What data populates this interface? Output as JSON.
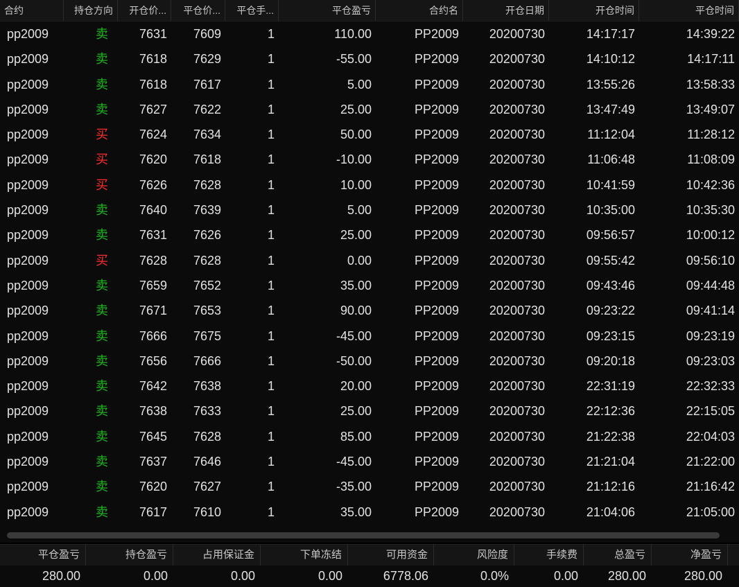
{
  "table": {
    "headers": [
      "合约",
      "持仓方向",
      "开仓价...",
      "平仓价...",
      "平仓手...",
      "平仓盈亏",
      "合约名",
      "开仓日期",
      "开仓时间",
      "平仓时间"
    ],
    "rows": [
      [
        "pp2009",
        "卖",
        "7631",
        "7609",
        "1",
        "110.00",
        "PP2009",
        "20200730",
        "14:17:17",
        "14:39:22"
      ],
      [
        "pp2009",
        "卖",
        "7618",
        "7629",
        "1",
        "-55.00",
        "PP2009",
        "20200730",
        "14:10:12",
        "14:17:11"
      ],
      [
        "pp2009",
        "卖",
        "7618",
        "7617",
        "1",
        "5.00",
        "PP2009",
        "20200730",
        "13:55:26",
        "13:58:33"
      ],
      [
        "pp2009",
        "卖",
        "7627",
        "7622",
        "1",
        "25.00",
        "PP2009",
        "20200730",
        "13:47:49",
        "13:49:07"
      ],
      [
        "pp2009",
        "买",
        "7624",
        "7634",
        "1",
        "50.00",
        "PP2009",
        "20200730",
        "11:12:04",
        "11:28:12"
      ],
      [
        "pp2009",
        "买",
        "7620",
        "7618",
        "1",
        "-10.00",
        "PP2009",
        "20200730",
        "11:06:48",
        "11:08:09"
      ],
      [
        "pp2009",
        "买",
        "7626",
        "7628",
        "1",
        "10.00",
        "PP2009",
        "20200730",
        "10:41:59",
        "10:42:36"
      ],
      [
        "pp2009",
        "卖",
        "7640",
        "7639",
        "1",
        "5.00",
        "PP2009",
        "20200730",
        "10:35:00",
        "10:35:30"
      ],
      [
        "pp2009",
        "卖",
        "7631",
        "7626",
        "1",
        "25.00",
        "PP2009",
        "20200730",
        "09:56:57",
        "10:00:12"
      ],
      [
        "pp2009",
        "买",
        "7628",
        "7628",
        "1",
        "0.00",
        "PP2009",
        "20200730",
        "09:55:42",
        "09:56:10"
      ],
      [
        "pp2009",
        "卖",
        "7659",
        "7652",
        "1",
        "35.00",
        "PP2009",
        "20200730",
        "09:43:46",
        "09:44:48"
      ],
      [
        "pp2009",
        "卖",
        "7671",
        "7653",
        "1",
        "90.00",
        "PP2009",
        "20200730",
        "09:23:22",
        "09:41:14"
      ],
      [
        "pp2009",
        "卖",
        "7666",
        "7675",
        "1",
        "-45.00",
        "PP2009",
        "20200730",
        "09:23:15",
        "09:23:19"
      ],
      [
        "pp2009",
        "卖",
        "7656",
        "7666",
        "1",
        "-50.00",
        "PP2009",
        "20200730",
        "09:20:18",
        "09:23:03"
      ],
      [
        "pp2009",
        "卖",
        "7642",
        "7638",
        "1",
        "20.00",
        "PP2009",
        "20200730",
        "22:31:19",
        "22:32:33"
      ],
      [
        "pp2009",
        "卖",
        "7638",
        "7633",
        "1",
        "25.00",
        "PP2009",
        "20200730",
        "22:12:36",
        "22:15:05"
      ],
      [
        "pp2009",
        "卖",
        "7645",
        "7628",
        "1",
        "85.00",
        "PP2009",
        "20200730",
        "21:22:38",
        "22:04:03"
      ],
      [
        "pp2009",
        "卖",
        "7637",
        "7646",
        "1",
        "-45.00",
        "PP2009",
        "20200730",
        "21:21:04",
        "21:22:00"
      ],
      [
        "pp2009",
        "卖",
        "7620",
        "7627",
        "1",
        "-35.00",
        "PP2009",
        "20200730",
        "21:12:16",
        "21:16:42"
      ],
      [
        "pp2009",
        "卖",
        "7617",
        "7610",
        "1",
        "35.00",
        "PP2009",
        "20200730",
        "21:04:06",
        "21:05:00"
      ]
    ],
    "direction_colors": {
      "卖": "#1fb51f",
      "买": "#ff2d2d"
    }
  },
  "summary": {
    "headers": [
      "平仓盈亏",
      "持仓盈亏",
      "占用保证金",
      "下单冻结",
      "可用资金",
      "风险度",
      "手续费",
      "总盈亏",
      "净盈亏"
    ],
    "values": [
      "280.00",
      "0.00",
      "0.00",
      "0.00",
      "6778.06",
      "0.0%",
      "0.00",
      "280.00",
      "280.00"
    ]
  }
}
